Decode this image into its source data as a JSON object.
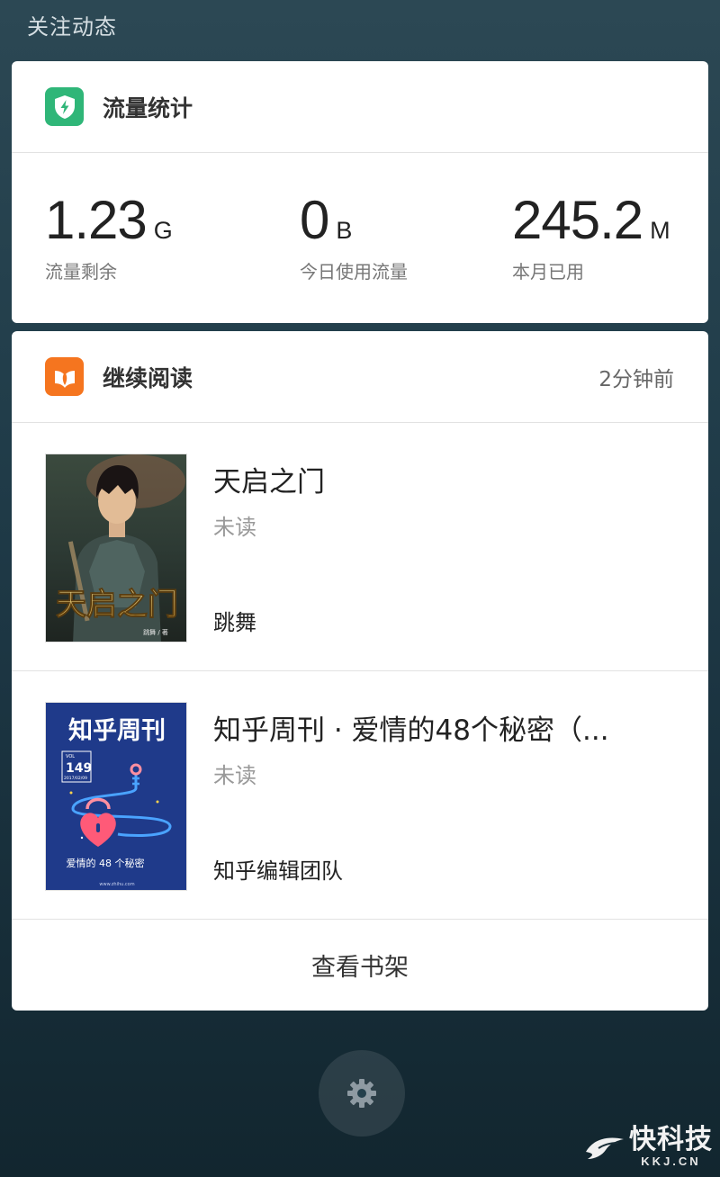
{
  "header": {
    "title": "关注动态"
  },
  "traffic_card": {
    "title": "流量统计",
    "icon": "shield-bolt-icon",
    "stats": [
      {
        "value": "1.23",
        "unit": "G",
        "label": "流量剩余"
      },
      {
        "value": "0",
        "unit": "B",
        "label": "今日使用流量"
      },
      {
        "value": "245.2",
        "unit": "M",
        "label": "本月已用"
      }
    ]
  },
  "reading_card": {
    "title": "继续阅读",
    "icon": "book-leaf-icon",
    "time": "2分钟前",
    "books": [
      {
        "title": "天启之门",
        "status": "未读",
        "author": "跳舞",
        "cover": {
          "title": "天启之门",
          "author": "跳舞 / 著"
        }
      },
      {
        "title": "知乎周刊 · 爱情的48个秘密（...",
        "status": "未读",
        "author": "知乎编辑团队",
        "cover": {
          "title": "知乎周刊",
          "vol": "VOL",
          "issue": "149",
          "date": "2017/02/09",
          "subtitle": "爱情的 48 个秘密",
          "url": "www.zhihu.com"
        }
      }
    ],
    "shelf_button": "查看书架"
  },
  "fab": {
    "icon": "gear-icon"
  },
  "watermark": {
    "main": "快科技",
    "sub": "KKJ.CN"
  },
  "colors": {
    "traffic_icon_bg": "#2fb678",
    "reading_icon_bg": "#f5751f",
    "zhihu_cover_bg": "#1f3a8a"
  }
}
